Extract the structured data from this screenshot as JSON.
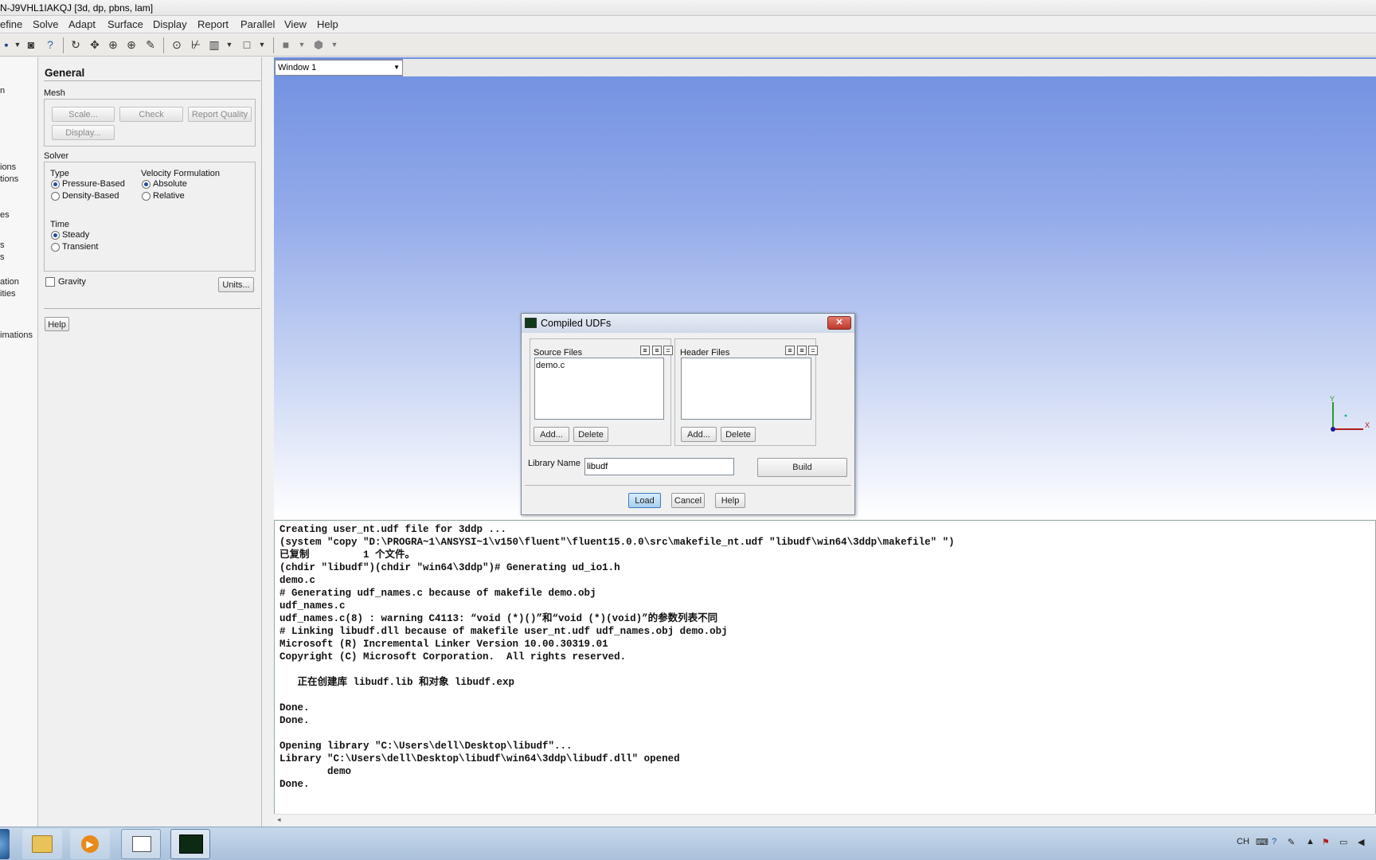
{
  "window": {
    "title": "N-J9VHL1IAKQJ  [3d, dp, pbns, lam]"
  },
  "menu": [
    "efine",
    "Solve",
    "Adapt",
    "Surface",
    "Display",
    "Report",
    "Parallel",
    "View",
    "Help"
  ],
  "toolbar": {
    "icons": [
      "save-icon",
      "dropdown-arrow-icon",
      "screenshot-icon",
      "help-icon",
      "rotate-icon",
      "pan-icon",
      "zoom-icon",
      "zoom-in-icon",
      "probe-icon",
      "zoom-to-fit-icon",
      "measure-icon",
      "view-layout-icon",
      "window-icon",
      "fill-color-icon",
      "transparency-icon"
    ]
  },
  "left_strip": {
    "items": [
      "n",
      "ions",
      "tions",
      "es",
      "s",
      "s",
      "ation",
      "ities",
      "imations"
    ]
  },
  "general": {
    "heading": "General",
    "mesh": {
      "label": "Mesh",
      "scale": "Scale...",
      "check": "Check",
      "report_quality": "Report Quality",
      "display": "Display..."
    },
    "solver": {
      "label": "Solver",
      "type_label": "Type",
      "pressure_based": "Pressure-Based",
      "density_based": "Density-Based",
      "velocity_label": "Velocity Formulation",
      "absolute": "Absolute",
      "relative": "Relative",
      "time_label": "Time",
      "steady": "Steady",
      "transient": "Transient"
    },
    "gravity": "Gravity",
    "units": "Units...",
    "help": "Help"
  },
  "viewport": {
    "window_select": "Window 1"
  },
  "dialog": {
    "title": "Compiled UDFs",
    "source_files_label": "Source Files",
    "source_files": [
      "demo.c"
    ],
    "header_files_label": "Header Files",
    "add": "Add...",
    "delete": "Delete",
    "library_name_label": "Library Name",
    "library_name_value": "libudf",
    "build": "Build",
    "load": "Load",
    "cancel": "Cancel",
    "help": "Help"
  },
  "console": {
    "text": "Creating user_nt.udf file for 3ddp ...\n(system \"copy \"D:\\PROGRA~1\\ANSYSI~1\\v150\\fluent\"\\fluent15.0.0\\src\\makefile_nt.udf \"libudf\\win64\\3ddp\\makefile\" \")\n已复制         1 个文件。\n(chdir \"libudf\")(chdir \"win64\\3ddp\")# Generating ud_io1.h\ndemo.c\n# Generating udf_names.c because of makefile demo.obj\nudf_names.c\nudf_names.c(8) : warning C4113: “void (*)()”和“void (*)(void)”的参数列表不同\n# Linking libudf.dll because of makefile user_nt.udf udf_names.obj demo.obj\nMicrosoft (R) Incremental Linker Version 10.00.30319.01\nCopyright (C) Microsoft Corporation.  All rights reserved.\n\n   正在创建库 libudf.lib 和对象 libudf.exp\n\nDone.\nDone.\n\nOpening library \"C:\\Users\\dell\\Desktop\\libudf\"...\nLibrary \"C:\\Users\\dell\\Desktop\\libudf\\win64\\3ddp\\libudf.dll\" opened\n        demo\nDone."
  },
  "taskbar": {
    "apps": [
      "start-button",
      "file-explorer-icon",
      "media-player-icon",
      "document-app-icon",
      "fluent-app-icon"
    ],
    "tray_lang": "CH"
  }
}
